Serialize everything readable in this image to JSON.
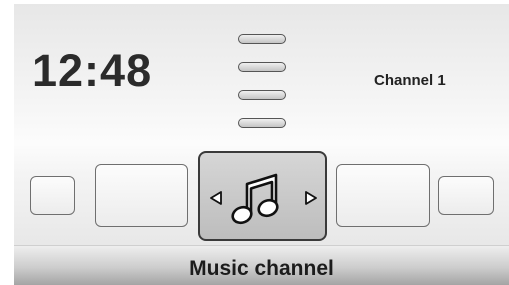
{
  "header": {
    "time": "12:48",
    "channel": "Channel 1"
  },
  "carousel": {
    "selected_icon": "music-note-icon",
    "prev_icon": "triangle-left-icon",
    "next_icon": "triangle-right-icon"
  },
  "footer": {
    "label": "Music channel"
  },
  "colors": {
    "text": "#222222",
    "tile_border": "#6f6f6f",
    "selected_tile": "#c8c8c8"
  }
}
